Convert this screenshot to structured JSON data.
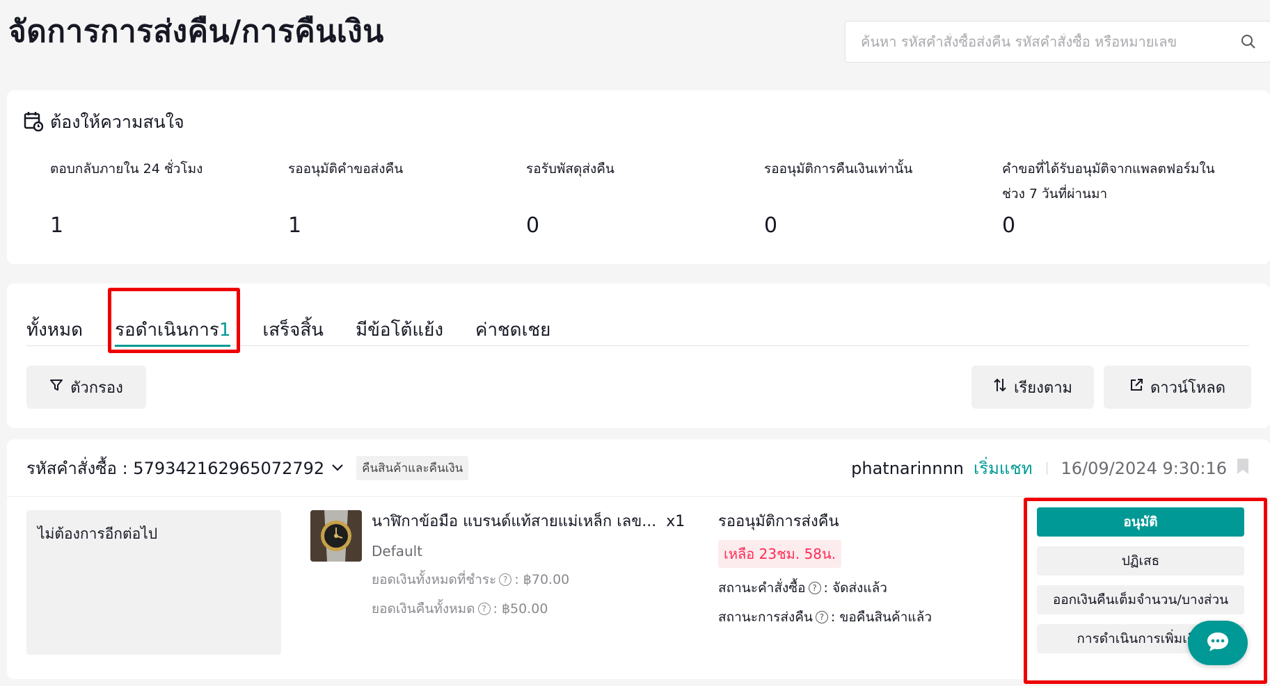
{
  "page": {
    "title": "จัดการการส่งคืน/การคืนเงิน"
  },
  "search": {
    "placeholder": "ค้นหา รหัสคำสั่งซื้อส่งคืน รหัสคำสั่งซื้อ หรือหมายเลข"
  },
  "attention": {
    "title": "ต้องให้ความสนใจ",
    "metrics": [
      {
        "label": "ตอบกลับภายใน 24 ชั่วโมง",
        "value": "1"
      },
      {
        "label": "รออนุมัติคำขอส่งคืน",
        "value": "1"
      },
      {
        "label": "รอรับพัสดุส่งคืน",
        "value": "0"
      },
      {
        "label": "รออนุมัติการคืนเงินเท่านั้น",
        "value": "0"
      },
      {
        "label": "คำขอที่ได้รับอนุมัติจากแพลตฟอร์มในช่วง 7 วันที่ผ่านมา",
        "value": "0"
      }
    ]
  },
  "tabs": [
    {
      "label": "ทั้งหมด",
      "count": ""
    },
    {
      "label": "รอดำเนินการ",
      "count": "1"
    },
    {
      "label": "เสร็จสิ้น",
      "count": ""
    },
    {
      "label": "มีข้อโต้แย้ง",
      "count": ""
    },
    {
      "label": "ค่าชดเชย",
      "count": ""
    }
  ],
  "toolbar": {
    "filter_label": "ตัวกรอง",
    "sort_label": "เรียงตาม",
    "download_label": "ดาวน์โหลด"
  },
  "order": {
    "id_label": "รหัสคำสั่งซื้อ : 579342162965072792",
    "type_tag": "คืนสินค้าและคืนเงิน",
    "buyer": "phatnarinnnn",
    "chat_label": "เริ่มแชท",
    "timestamp": "16/09/2024 9:30:16",
    "reason": "ไม่ต้องการอีกต่อไป",
    "product": {
      "name": "นาฬิกาข้อมือ แบรนด์แท้สายแม่เหล็ก เลข...",
      "qty": "x1",
      "variant": "Default",
      "total_paid_label": "ยอดเงินทั้งหมดที่ชำระ",
      "total_paid_value": ": ฿70.00",
      "total_refund_label": "ยอดเงินคืนทั้งหมด",
      "total_refund_value": ": ฿50.00"
    },
    "status": {
      "title": "รออนุมัติการส่งคืน",
      "countdown": "เหลือ 23ชม. 58น.",
      "order_status_label": "สถานะคำสั่งซื้อ",
      "order_status_value": ": จัดส่งแล้ว",
      "return_status_label": "สถานะการส่งคืน",
      "return_status_value": ": ขอคืนสินค้าแล้ว"
    },
    "actions": {
      "approve": "อนุมัติ",
      "reject": "ปฏิเสธ",
      "refund": "ออกเงินคืนเต็มจำนวน/บางส่วน",
      "more": "การดำเนินการเพิ่มเติม"
    }
  },
  "colors": {
    "accent": "#009995",
    "warning": "#fe2c55",
    "highlight": "#ee0000"
  }
}
